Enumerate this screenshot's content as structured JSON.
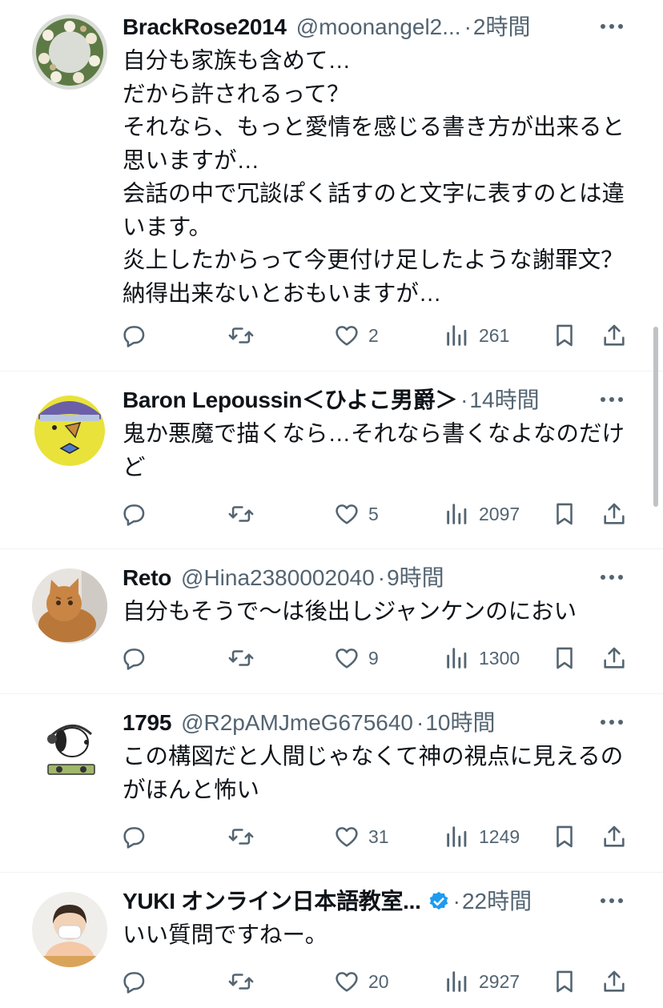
{
  "tweets": [
    {
      "name": "BrackRose2014",
      "handle": "@moonangel2...",
      "time": "2時間",
      "text": "自分も家族も含めて…\nだから許されるって？\nそれなら、もっと愛情を感じる書き方が出来ると思いますが…\n会話の中で冗談ぽく話すのと文字に表すのとは違います。\n炎上したからって今更付け足したような謝罪文？納得出来ないとおもいますが…",
      "likes": "2",
      "views": "261",
      "avatar_icon": "rose-wreath-avatar"
    },
    {
      "name": "Baron Lepoussin＜ひよこ男爵＞",
      "handle": "",
      "time": "14時間",
      "text": "鬼か悪魔で描くなら…それなら書くなよなのだけど",
      "likes": "5",
      "views": "2097",
      "avatar_icon": "chick-baron-avatar"
    },
    {
      "name": "Reto",
      "handle": "@Hina2380002040",
      "time": "9時間",
      "text": "自分もそうで〜は後出しジャンケンのにおい",
      "likes": "9",
      "views": "1300",
      "avatar_icon": "cat-avatar"
    },
    {
      "name": "1795",
      "handle": "@R2pAMJmeG675640",
      "time": "10時間",
      "text": "この構図だと人間じゃなくて神の視点に見えるのがほんと怖い",
      "likes": "31",
      "views": "1249",
      "avatar_icon": "dog-dj-avatar"
    },
    {
      "name": "YUKI オンライン日本語教室...",
      "handle": "",
      "time": "22時間",
      "text": "いい質問ですねー。",
      "likes": "20",
      "views": "2927",
      "avatar_icon": "person-photo-avatar",
      "verified": true
    }
  ],
  "icons": {
    "reply": "reply-icon",
    "retweet": "retweet-icon",
    "like": "heart-icon",
    "views": "views-icon",
    "bookmark": "bookmark-icon",
    "share": "share-icon",
    "more": "more-icon"
  },
  "colors": {
    "text": "#0f1419",
    "secondary": "#536471",
    "verified": "#1d9bf0",
    "divider": "#eff3f4"
  }
}
